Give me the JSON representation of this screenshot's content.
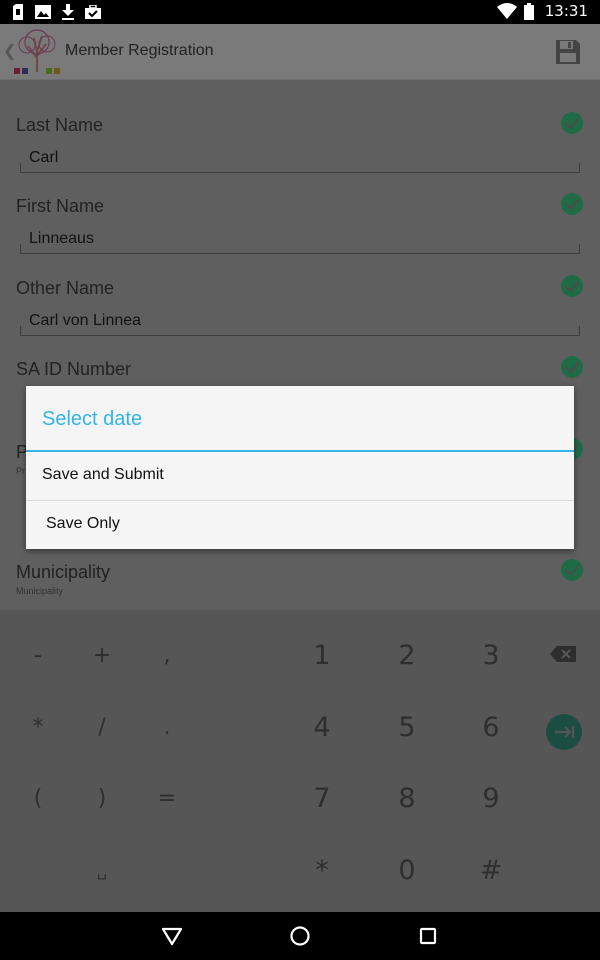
{
  "status_bar": {
    "time": "13:31",
    "left_icons": [
      "sim-icon",
      "image-icon",
      "download-icon",
      "briefcase-icon"
    ],
    "right_icons": [
      "wifi-icon",
      "battery-icon"
    ]
  },
  "app_bar": {
    "title": "Member Registration",
    "back_icon": "chevron-left-icon",
    "logo_icon": "tree-logo-icon",
    "action_icon": "save-icon"
  },
  "form": {
    "fields": [
      {
        "label": "Last Name",
        "value": "Carl"
      },
      {
        "label": "First Name",
        "value": "Linneaus"
      },
      {
        "label": "Other Name",
        "value": "Carl von Linnea"
      },
      {
        "label": "SA ID Number",
        "value": ""
      },
      {
        "label": "P",
        "value": ""
      },
      {
        "label": "Municipality",
        "value": ""
      }
    ],
    "hints": [
      "Pr",
      "Municipality"
    ],
    "valid_color": "#1f6b45"
  },
  "dialog": {
    "title": "Select date",
    "items": [
      "Save and Submit",
      "Save Only"
    ],
    "accent": "#33b5e5"
  },
  "keyboard": {
    "rows": [
      [
        "-",
        "+",
        ",",
        "1",
        "2",
        "3"
      ],
      [
        "*",
        "/",
        ".",
        "4",
        "5",
        "6"
      ],
      [
        "(",
        ")",
        "=",
        "7",
        "8",
        "9"
      ],
      [
        "␣",
        "*",
        "0",
        "#"
      ]
    ],
    "special_icons": [
      "backspace-icon",
      "next-icon"
    ]
  },
  "nav_bar": {
    "icons": [
      "back-triangle-icon",
      "home-circle-icon",
      "recents-square-icon"
    ]
  }
}
